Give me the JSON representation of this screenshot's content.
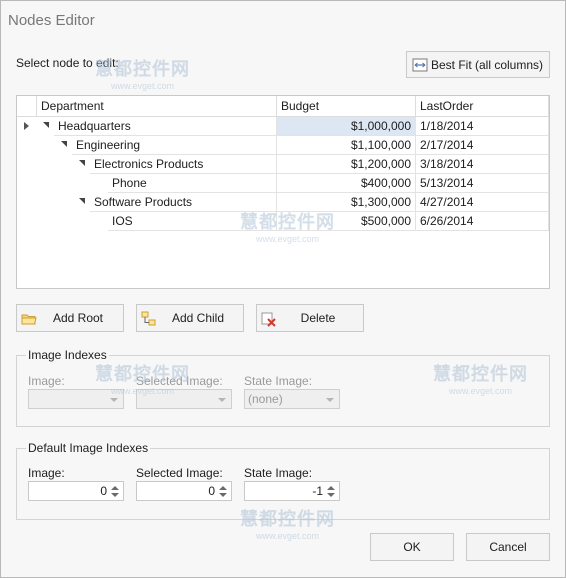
{
  "window": {
    "title": "Nodes Editor"
  },
  "select_label": "Select node to edit:",
  "best_fit_label": "Best Fit (all columns)",
  "grid": {
    "columns": [
      "Department",
      "Budget",
      "LastOrder"
    ],
    "rows": [
      {
        "department": "Headquarters",
        "budget": "$1,000,000",
        "last_order": "1/18/2014"
      },
      {
        "department": "Engineering",
        "budget": "$1,100,000",
        "last_order": "2/17/2014"
      },
      {
        "department": "Electronics Products",
        "budget": "$1,200,000",
        "last_order": "3/18/2014"
      },
      {
        "department": "Phone",
        "budget": "$400,000",
        "last_order": "5/13/2014"
      },
      {
        "department": "Software Products",
        "budget": "$1,300,000",
        "last_order": "4/27/2014"
      },
      {
        "department": "IOS",
        "budget": "$500,000",
        "last_order": "6/26/2014"
      }
    ]
  },
  "buttons": {
    "add_root": "Add Root",
    "add_child": "Add Child",
    "delete": "Delete",
    "ok": "OK",
    "cancel": "Cancel"
  },
  "image_indexes": {
    "title": "Image Indexes",
    "image_label": "Image:",
    "selected_image_label": "Selected Image:",
    "state_image_label": "State Image:",
    "image_value": "",
    "selected_image_value": "",
    "state_image_value": "(none)"
  },
  "default_image_indexes": {
    "title": "Default Image Indexes",
    "image_label": "Image:",
    "selected_image_label": "Selected Image:",
    "state_image_label": "State Image:",
    "image_value": "0",
    "selected_image_value": "0",
    "state_image_value": "-1"
  },
  "watermark": {
    "text": "慧都控件网",
    "url": "www.evget.com"
  }
}
